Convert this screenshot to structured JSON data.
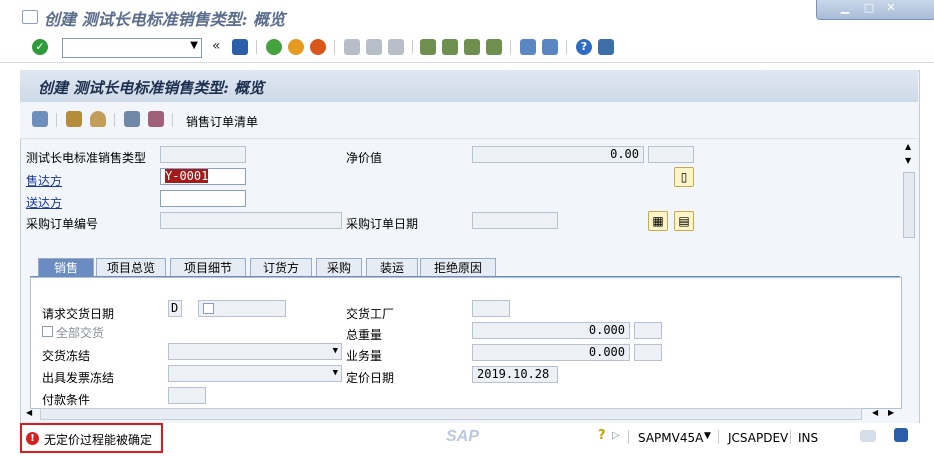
{
  "window": {
    "title": "创建 测试长电标准销售类型: 概览"
  },
  "toolbar": {
    "command_value": "",
    "back_symbol": "«"
  },
  "screen": {
    "title": "创建 测试长电标准销售类型: 概览"
  },
  "app_toolbar": {
    "order_list_label": "销售订单清单"
  },
  "header": {
    "order_type_label": "测试长电标准销售类型",
    "order_type_value": "",
    "net_value_label": "净价值",
    "net_value": "0.00",
    "currency": "",
    "sold_to_label": "售达方",
    "sold_to_value": "Y-0001",
    "ship_to_label": "送达方",
    "ship_to_value": "",
    "po_number_label": "采购订单编号",
    "po_number_value": "",
    "po_date_label": "采购订单日期",
    "po_date_value": ""
  },
  "tabs": [
    "销售",
    "项目总览",
    "项目细节",
    "订货方",
    "采购",
    "装运",
    "拒绝原因"
  ],
  "sales_tab": {
    "req_delivery_date_label": "请求交货日期",
    "req_delivery_date_type": "D",
    "complete_delivery_label": "全部交货",
    "delivery_block_label": "交货冻结",
    "billing_block_label": "出具发票冻结",
    "payment_terms_label": "付款条件",
    "delivering_plant_label": "交货工厂",
    "total_weight_label": "总重量",
    "total_weight_value": "0.000",
    "volume_label": "业务量",
    "volume_value": "0.000",
    "pricing_date_label": "定价日期",
    "pricing_date_value": "2019.10.28"
  },
  "status": {
    "message": "无定价过程能被确定",
    "program": "SAPMV45A",
    "system": "JCSAPDEV",
    "mode": "INS",
    "logo": "SAP"
  },
  "colors": {
    "error": "#e01a1a",
    "tab_active": "#6a8cc0",
    "header_bg": "#cfdae8"
  },
  "icons": [
    "check-icon",
    "save-icon",
    "back-icon",
    "exit-icon",
    "cancel-icon",
    "print-icon",
    "find-icon",
    "find-next-icon",
    "first-page-icon",
    "previous-page-icon",
    "next-page-icon",
    "last-page-icon",
    "create-session-icon",
    "shortcut-icon",
    "help-icon",
    "customize-layout-icon"
  ]
}
